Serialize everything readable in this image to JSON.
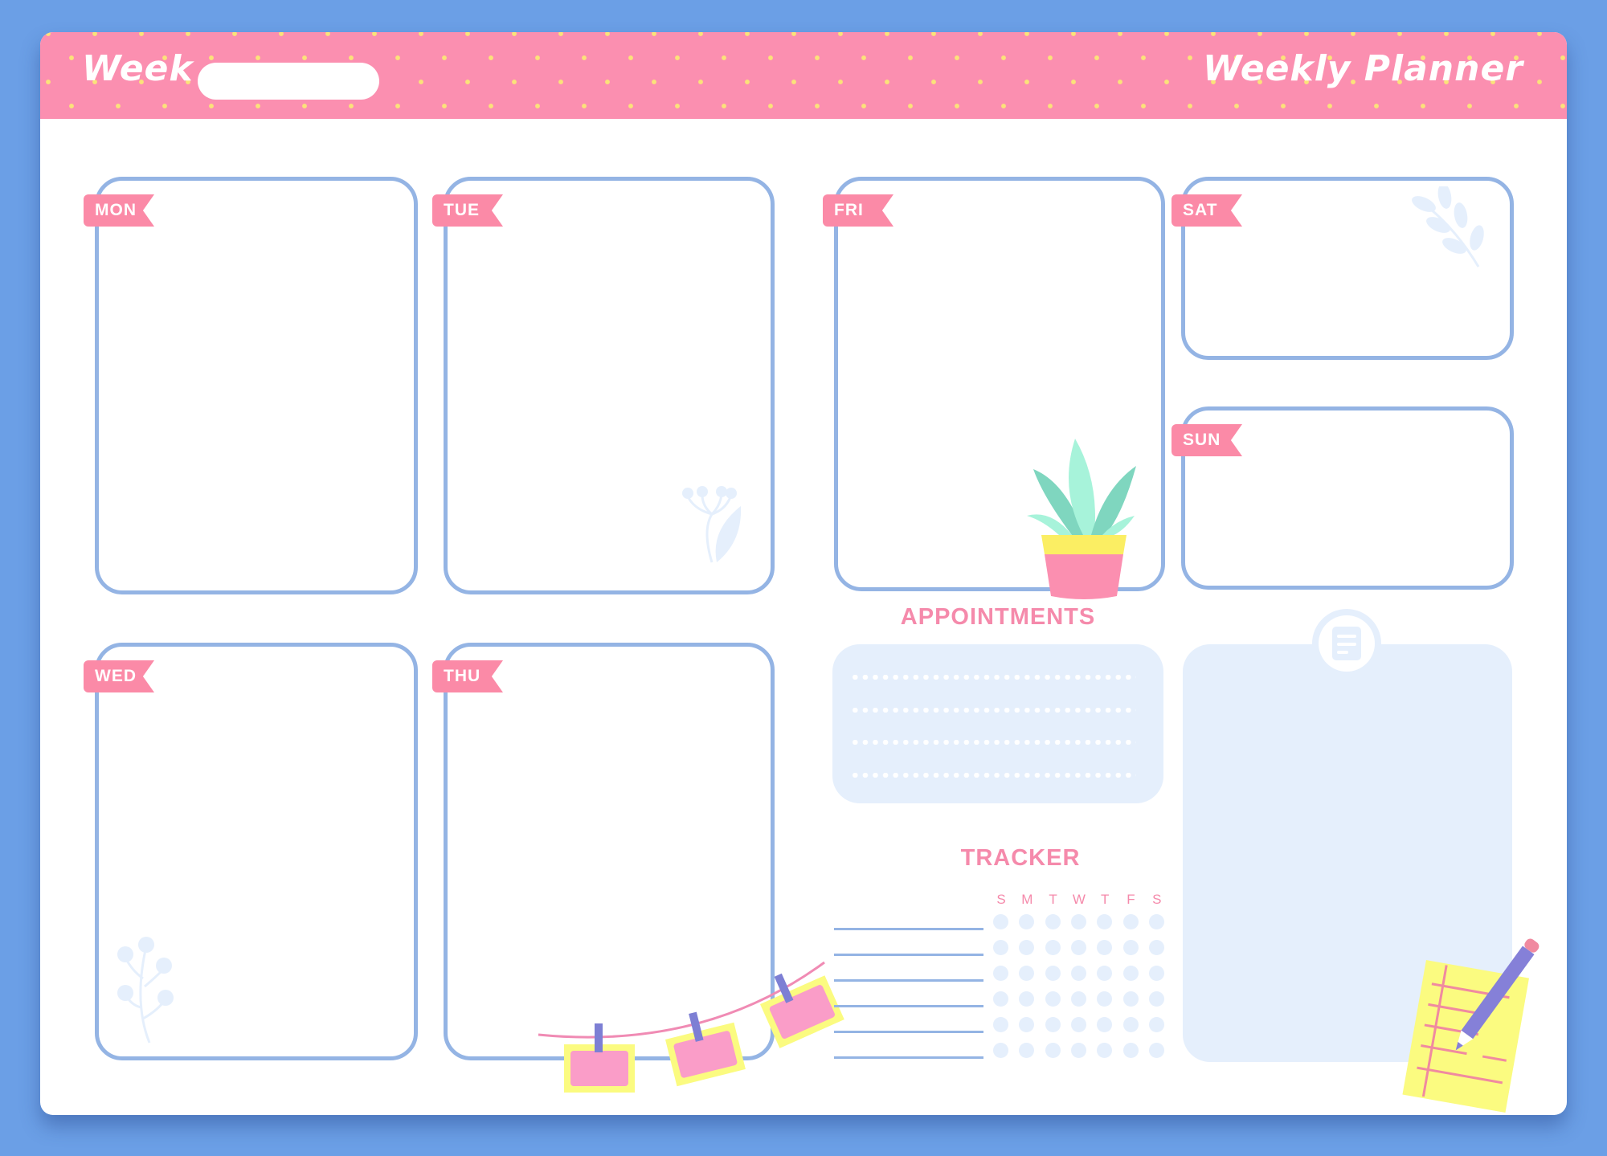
{
  "header": {
    "week_label": "Week",
    "week_input_value": "",
    "week_input_placeholder": "",
    "title": "Weekly Planner"
  },
  "days": [
    {
      "key": "mon",
      "label": "MON"
    },
    {
      "key": "tue",
      "label": "TUE"
    },
    {
      "key": "wed",
      "label": "WED"
    },
    {
      "key": "thu",
      "label": "THU"
    },
    {
      "key": "fri",
      "label": "FRI"
    },
    {
      "key": "sat",
      "label": "SAT"
    },
    {
      "key": "sun",
      "label": "SUN"
    }
  ],
  "appointments": {
    "title": "APPOINTMENTS",
    "line_count": 4
  },
  "tracker": {
    "title": "TRACKER",
    "weekday_headers": [
      "S",
      "M",
      "T",
      "W",
      "T",
      "F",
      "S"
    ],
    "habit_rows": 6
  },
  "notes": {
    "icon": "note-icon"
  },
  "decorations": [
    "plant-pot-icon",
    "hanging-photos-icon",
    "notepad-pencil-icon",
    "leaf-branch-icon",
    "flower-sprig-icon",
    "berry-branch-icon"
  ],
  "colors": {
    "background": "#6b9fe6",
    "banner": "#fb8fb0",
    "banner_dots": "#fbe27a",
    "box_border": "#94b4e4",
    "tag": "#fb8aa7",
    "section_title": "#f58aab",
    "light_fill": "#e5effc"
  }
}
